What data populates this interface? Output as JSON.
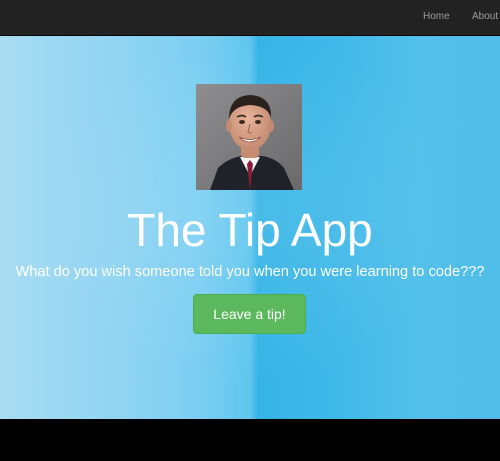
{
  "navbar": {
    "links": [
      {
        "label": "Home"
      },
      {
        "label": "About"
      }
    ]
  },
  "hero": {
    "avatar_icon": "person-photo-icon",
    "title": "The Tip App",
    "subtitle": "What do you wish someone told you when you were learning to code???",
    "cta_label": "Leave a tip!"
  },
  "colors": {
    "navbar_bg": "#222222",
    "nav_link": "#9d9d9d",
    "hero_bg_light": "#a8dcf2",
    "hero_bg_accent": "#35b4e6",
    "button_bg": "#5cb85c",
    "text": "#ffffff"
  }
}
